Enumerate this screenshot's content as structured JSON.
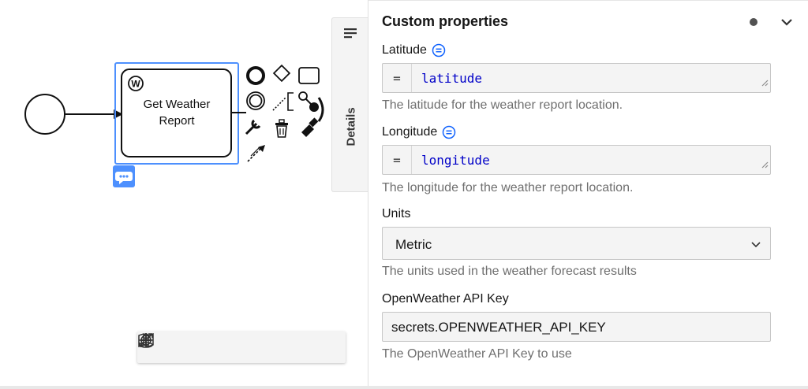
{
  "diagram": {
    "task_label_line1": "Get Weather",
    "task_label_line2": "Report",
    "task_badge": "W"
  },
  "details_tab": {
    "label": "Details"
  },
  "panel": {
    "group_title": "Custom properties",
    "fields": {
      "latitude": {
        "label": "Latitude",
        "prefix": "=",
        "value": "latitude",
        "description": "The latitude for the weather report location."
      },
      "longitude": {
        "label": "Longitude",
        "prefix": "=",
        "value": "longitude",
        "description": "The longitude for the weather report location."
      },
      "units": {
        "label": "Units",
        "value": "Metric",
        "description": "The units used in the weather forecast results"
      },
      "api_key": {
        "label": "OpenWeather API Key",
        "value": "secrets.OPENWEATHER_API_KEY",
        "description": "The OpenWeather API Key to use"
      }
    }
  },
  "colors": {
    "selection": "#4d90fe",
    "feel_value": "#0000c8",
    "field_bg": "#f4f4f4",
    "description": "#6f6f6f"
  },
  "icons": {
    "toolbar": [
      "reset-view-icon",
      "fullscreen-icon",
      "minimap-icon",
      "center-icon",
      "zoom-out-icon",
      "zoom-in-icon"
    ],
    "context_pad": [
      "end-event-icon",
      "gateway-icon",
      "task-icon",
      "intermediate-event-icon",
      "text-annotation-icon",
      "append-search-icon",
      "change-type-icon",
      "delete-icon",
      "color-icon",
      "connect-icon"
    ]
  }
}
